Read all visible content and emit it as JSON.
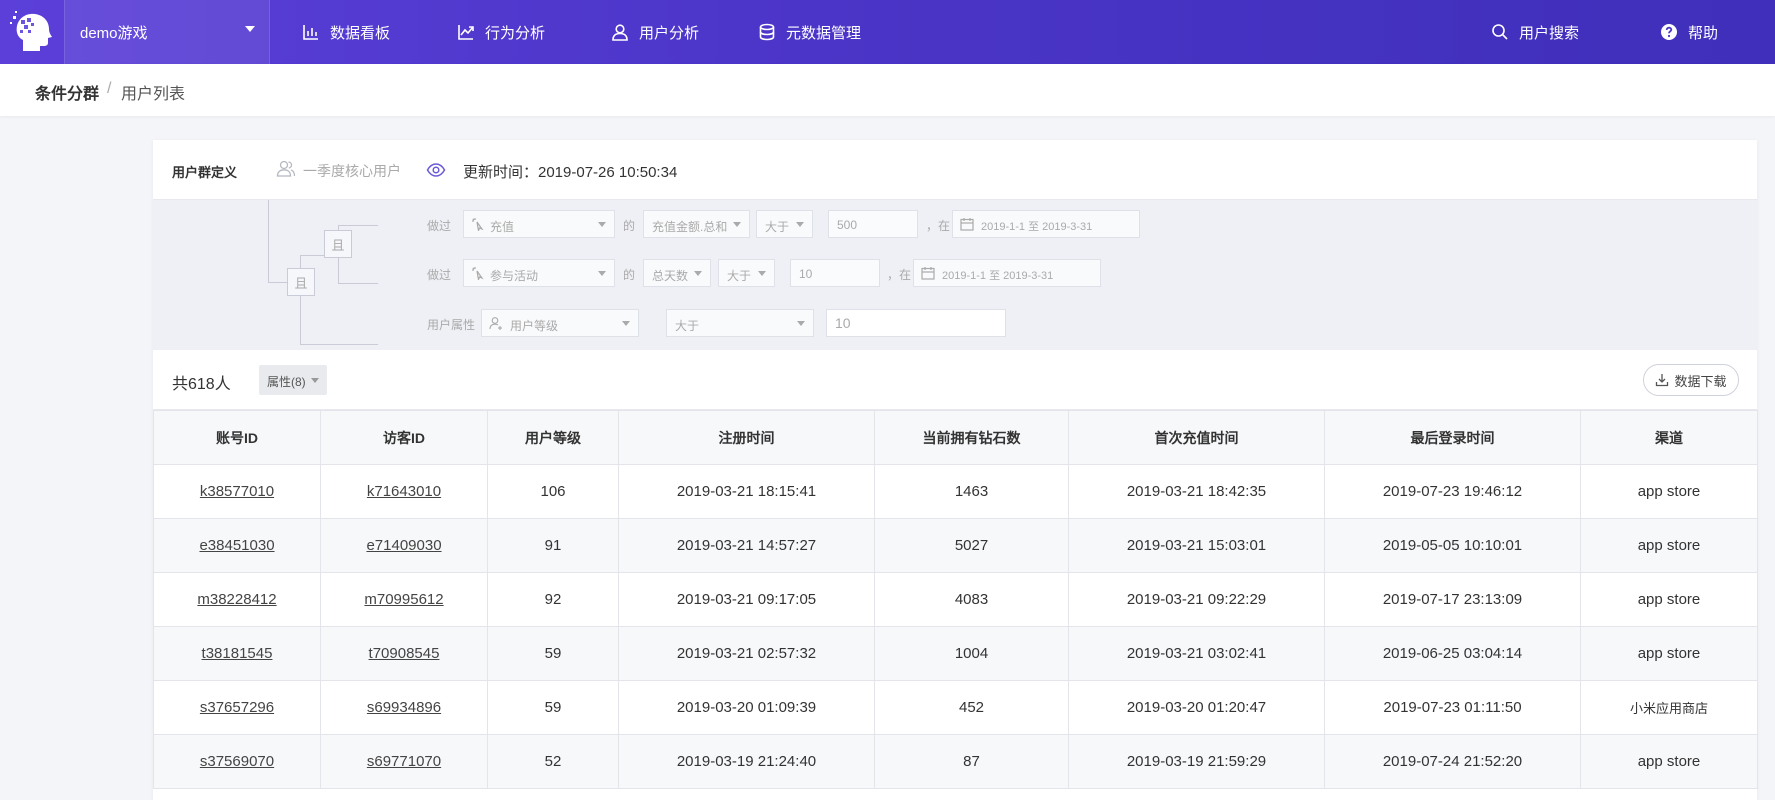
{
  "nav": {
    "project": "demo游戏",
    "items": [
      {
        "label": "数据看板",
        "icon": "bar-chart-icon"
      },
      {
        "label": "行为分析",
        "icon": "trend-icon"
      },
      {
        "label": "用户分析",
        "icon": "user-icon"
      },
      {
        "label": "元数据管理",
        "icon": "database-icon"
      }
    ],
    "search": "用户搜索",
    "help": "帮助"
  },
  "breadcrumb": {
    "parent": "条件分群",
    "separator": "/",
    "current": "用户列表"
  },
  "definition": {
    "label": "用户群定义",
    "group_name": "一季度核心用户",
    "update_time": "更新时间：2019-07-26 10:50:34"
  },
  "conditions": {
    "and_label": "且",
    "rows": [
      {
        "prefix": "做过",
        "event": "充值",
        "of": "的",
        "metric": "充值金额.总和",
        "op": "大于",
        "value": "500",
        "in": "，在",
        "date": "2019-1-1 至 2019-3-31"
      },
      {
        "prefix": "做过",
        "event": "参与活动",
        "of": "的",
        "metric": "总天数",
        "op": "大于",
        "value": "10",
        "in": "，在",
        "date": "2019-1-1 至 2019-3-31"
      }
    ],
    "attr_row": {
      "prefix": "用户属性",
      "attr": "用户等级",
      "op": "大于",
      "value": "10"
    }
  },
  "summary": {
    "total": "共618人",
    "attr_btn": "属性(8)",
    "download": "数据下载"
  },
  "table": {
    "headers": [
      "账号ID",
      "访客ID",
      "用户等级",
      "注册时间",
      "当前拥有钻石数",
      "首次充值时间",
      "最后登录时间",
      "渠道"
    ],
    "rows": [
      [
        "k38577010",
        "k71643010",
        "106",
        "2019-03-21 18:15:41",
        "1463",
        "2019-03-21 18:42:35",
        "2019-07-23 19:46:12",
        "app store"
      ],
      [
        "e38451030",
        "e71409030",
        "91",
        "2019-03-21 14:57:27",
        "5027",
        "2019-03-21 15:03:01",
        "2019-05-05 10:10:01",
        "app store"
      ],
      [
        "m38228412",
        "m70995612",
        "92",
        "2019-03-21 09:17:05",
        "4083",
        "2019-03-21 09:22:29",
        "2019-07-17 23:13:09",
        "app store"
      ],
      [
        "t38181545",
        "t70908545",
        "59",
        "2019-03-21 02:57:32",
        "1004",
        "2019-03-21 03:02:41",
        "2019-06-25 03:04:14",
        "app store"
      ],
      [
        "s37657296",
        "s69934896",
        "59",
        "2019-03-20 01:09:39",
        "452",
        "2019-03-20 01:20:47",
        "2019-07-23 01:11:50",
        "小米应用商店"
      ],
      [
        "s37569070",
        "s69771070",
        "52",
        "2019-03-19 21:24:40",
        "87",
        "2019-03-19 21:59:29",
        "2019-07-24 21:52:20",
        "app store"
      ]
    ]
  },
  "colors": {
    "nav_start": "#5b3fd8",
    "nav_end": "#3f2fba",
    "accent_icon": "#6a5ad8"
  }
}
